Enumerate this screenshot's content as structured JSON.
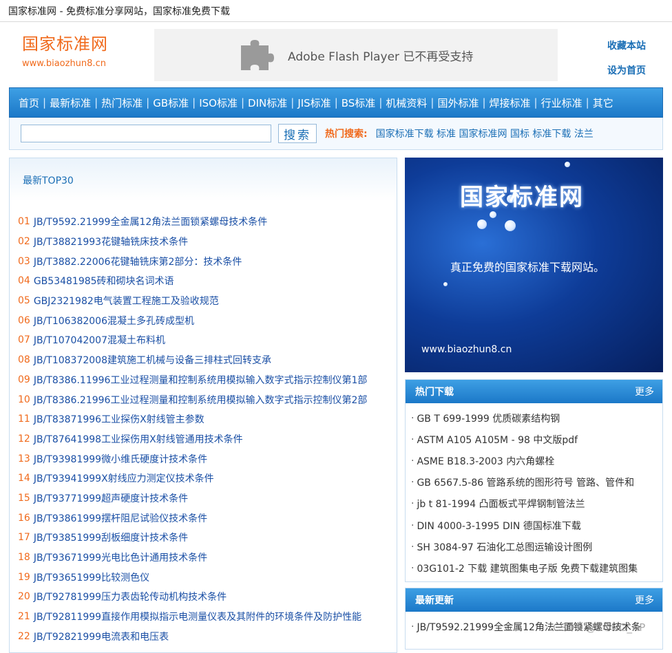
{
  "window": {
    "title": "国家标准网 - 免费标准分享网站，国家标准免费下载"
  },
  "logo": {
    "name": "国家标准网",
    "url": "www.biaozhun8.cn"
  },
  "flash": {
    "text": "Adobe Flash Player 已不再受支持",
    "icon": "puzzle-icon"
  },
  "toplinks": {
    "bookmark": "收藏本站",
    "homepage": "设为首页"
  },
  "nav": {
    "items": [
      {
        "label": "首页"
      },
      {
        "label": "最新标准"
      },
      {
        "label": "热门标准"
      },
      {
        "label": "GB标准"
      },
      {
        "label": "ISO标准"
      },
      {
        "label": "DIN标准"
      },
      {
        "label": "JIS标准"
      },
      {
        "label": "BS标准"
      },
      {
        "label": "机械资料"
      },
      {
        "label": "国外标准"
      },
      {
        "label": "焊接标准"
      },
      {
        "label": "行业标准"
      },
      {
        "label": "其它"
      }
    ],
    "separator": "|"
  },
  "search": {
    "value": "",
    "button": "搜索",
    "hot_label": "热门搜索:",
    "hot_words": "国家标准下载 标准 国家标准网 国标 标准下载 法兰"
  },
  "top30": {
    "heading": "最新TOP30",
    "items": [
      {
        "num": "01",
        "title": "JB/T9592.21999全金属12角法兰面锁紧螺母技术条件"
      },
      {
        "num": "02",
        "title": "JB/T38821993花键轴铣床技术条件"
      },
      {
        "num": "03",
        "title": "JB/T3882.22006花键轴铣床第2部分：技术条件"
      },
      {
        "num": "04",
        "title": "GB53481985砖和砌块名词术语"
      },
      {
        "num": "05",
        "title": "GBJ2321982电气装置工程施工及验收规范"
      },
      {
        "num": "06",
        "title": "JB/T106382006混凝土多孔砖成型机"
      },
      {
        "num": "07",
        "title": "JB/T107042007混凝土布料机"
      },
      {
        "num": "08",
        "title": "JB/T108372008建筑施工机械与设备三排柱式回转支承"
      },
      {
        "num": "09",
        "title": "JB/T8386.11996工业过程测量和控制系统用模拟输入数字式指示控制仪第1部"
      },
      {
        "num": "10",
        "title": "JB/T8386.21996工业过程测量和控制系统用模拟输入数字式指示控制仪第2部"
      },
      {
        "num": "11",
        "title": "JB/T83871996工业探伤X射线管主参数"
      },
      {
        "num": "12",
        "title": "JB/T87641998工业探伤用X射线管通用技术条件"
      },
      {
        "num": "13",
        "title": "JB/T93981999微小维氏硬度计技术条件"
      },
      {
        "num": "14",
        "title": "JB/T93941999X射线应力测定仪技术条件"
      },
      {
        "num": "15",
        "title": "JB/T93771999超声硬度计技术条件"
      },
      {
        "num": "16",
        "title": "JB/T93861999摆杆阻尼试验仪技术条件"
      },
      {
        "num": "17",
        "title": "JB/T93851999刮板细度计技术条件"
      },
      {
        "num": "18",
        "title": "JB/T93671999光电比色计通用技术条件"
      },
      {
        "num": "19",
        "title": "JB/T93651999比较测色仪"
      },
      {
        "num": "20",
        "title": "JB/T92781999压力表齿轮传动机构技术条件"
      },
      {
        "num": "21",
        "title": "JB/T92811999直接作用模拟指示电测量仪表及其附件的环境条件及防护性能"
      },
      {
        "num": "22",
        "title": "JB/T92821999电流表和电压表"
      }
    ]
  },
  "banner": {
    "title": "国家标准网",
    "subtitle": "真正免费的国家标准下载网站。",
    "url": "www.biaozhun8.cn"
  },
  "hot_downloads": {
    "heading": "热门下载",
    "more": "更多",
    "items": [
      {
        "title": "GB T 699-1999 优质碳素结构钢"
      },
      {
        "title": "ASTM A105 A105M - 98 中文版pdf"
      },
      {
        "title": "ASME B18.3-2003 内六角螺栓"
      },
      {
        "title": "GB 6567.5-86 管路系统的图形符号 管路、管件和"
      },
      {
        "title": "jb t 81-1994 凸面板式平焊钢制管法兰"
      },
      {
        "title": "DIN 4000-3-1995 DIN 德国标准下载"
      },
      {
        "title": "SH 3084-97 石油化工总图运输设计图例"
      },
      {
        "title": "03G101-2 下载 建筑图集电子版 免费下载建筑图集"
      }
    ]
  },
  "latest_updates": {
    "heading": "最新更新",
    "more": "更多",
    "items": [
      {
        "title": "JB/T9592.21999全金属12角法兰面锁紧螺母技术条"
      }
    ]
  },
  "watermark": "CSDN @ZONG_XP",
  "colors": {
    "accent": "#1a6eb5",
    "orange": "#f06a1c",
    "nav_top": "#3e9fe4",
    "nav_bottom": "#1b78c8"
  }
}
